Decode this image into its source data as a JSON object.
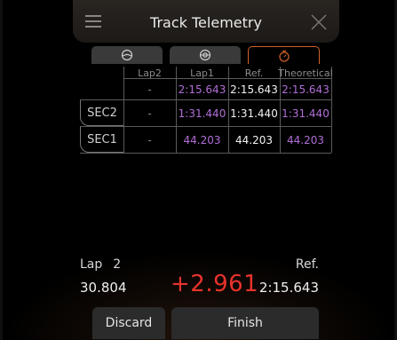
{
  "header": {
    "title": "Track Telemetry"
  },
  "icons": {
    "menu": "menu-icon",
    "close": "close-icon",
    "tab1": "steering-wheel-icon",
    "tab2": "crosshair-icon",
    "tab3": "stopwatch-icon"
  },
  "table": {
    "columns": [
      "Lap2",
      "Lap1",
      "Ref.",
      "Theoretical"
    ],
    "total_row": [
      "-",
      "2:15.643",
      "2:15.643",
      "2:15.643"
    ],
    "rows": [
      {
        "label": "SEC2",
        "values": [
          "-",
          "1:31.440",
          "1:31.440",
          "1:31.440"
        ]
      },
      {
        "label": "SEC1",
        "values": [
          "-",
          "44.203",
          "44.203",
          "44.203"
        ]
      }
    ]
  },
  "lap": {
    "label": "Lap",
    "number": "2",
    "time": "30.804"
  },
  "delta": "+2.961",
  "reference": {
    "label": "Ref.",
    "time": "2:15.643"
  },
  "buttons": {
    "discard": "Discard",
    "finish": "Finish"
  },
  "colors": {
    "accent": "#d0622a",
    "purple": "#b06ed6",
    "delta_red": "#e8322c"
  }
}
